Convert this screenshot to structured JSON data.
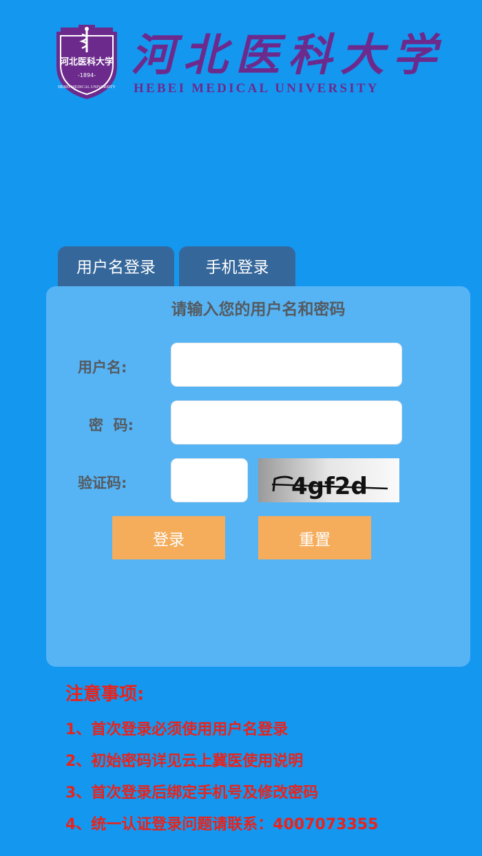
{
  "header": {
    "name_cn": "河北医科大学",
    "name_en": "HEBEI MEDICAL UNIVERSITY",
    "emblem_text": "河北医科大学",
    "emblem_year": "-1894-",
    "emblem_ring": "HEBEI MEDICAL UNIVERSITY"
  },
  "tabs": [
    {
      "label": "用户名登录"
    },
    {
      "label": "手机登录"
    }
  ],
  "form": {
    "title": "请输入您的用户名和密码",
    "username_label": "用户名:",
    "password_label": "密  码:",
    "captcha_label": "验证码:",
    "username_value": "",
    "password_value": "",
    "captcha_value": "",
    "captcha_text": "4gf2d",
    "login_label": "登录",
    "reset_label": "重置"
  },
  "notes": {
    "title": "注意事项:",
    "items": [
      "1、首次登录必须使用用户名登录",
      "2、初始密码详见云上冀医使用说明",
      "3、首次登录后绑定手机号及修改密码",
      "4、统一认证登录问题请联系：4007073355"
    ]
  },
  "colors": {
    "background": "#1497ef",
    "tab": "#35679a",
    "panel": "#56b4f4",
    "button": "#f5ac5b",
    "brand": "#6c2b8c",
    "notice": "#e8231c"
  }
}
